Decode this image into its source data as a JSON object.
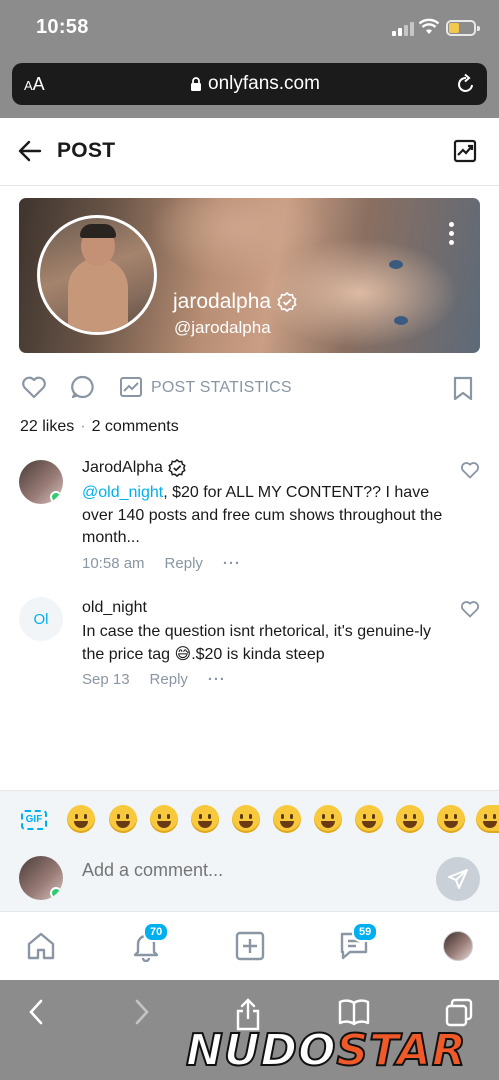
{
  "status_bar": {
    "time": "10:58"
  },
  "browser": {
    "aa_label": "AA",
    "url": "onlyfans.com"
  },
  "header": {
    "title": "POST"
  },
  "profile": {
    "display_name": "jarodalpha",
    "handle": "@jarodalpha"
  },
  "actions": {
    "post_statistics": "POST STATISTICS"
  },
  "counts": {
    "likes": "22 likes",
    "separator": "·",
    "comments": "2 comments"
  },
  "comments": [
    {
      "author": "JarodAlpha",
      "mention": "@old_night",
      "text": ", $20 for ALL MY CONTENT?? I have over 140 posts and free cum shows throughout the month...",
      "time": "10:58 am",
      "reply": "Reply",
      "more": "···"
    },
    {
      "author": "old_night",
      "initials": "Ol",
      "text_before": "In case the question isnt rhetorical, it's genuine-ly the price tag ",
      "emoji": "😅",
      "text_after": ".$20 is kinda steep",
      "time": "Sep 13",
      "reply": "Reply",
      "more": "···"
    }
  ],
  "emoji_bar": {
    "gif_label": "GIF",
    "emoji_count": 11
  },
  "comment_input": {
    "placeholder": "Add a comment..."
  },
  "bottom_nav": {
    "notifications_badge": "70",
    "messages_badge": "59"
  },
  "watermark": {
    "part1": "NUDO",
    "part2": "STAR"
  },
  "colors": {
    "accent": "#00aff0",
    "muted": "#8a96a3",
    "online": "#2ecc71",
    "chrome": "#8c8c8c"
  }
}
